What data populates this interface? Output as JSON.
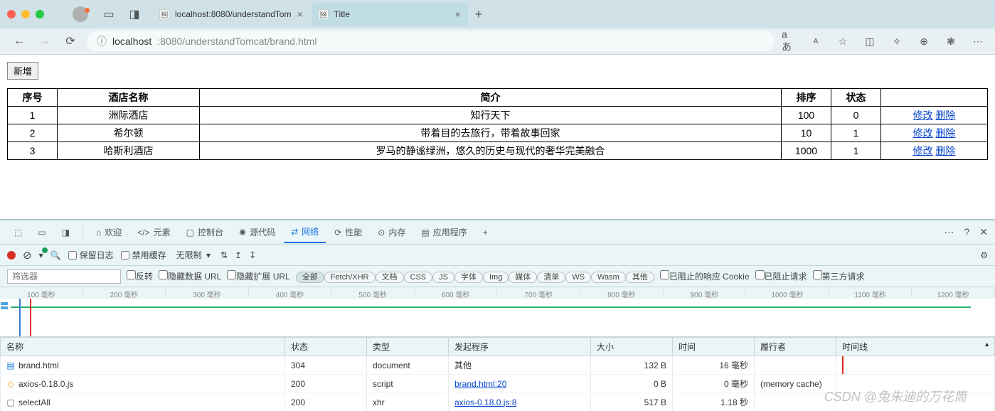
{
  "browser": {
    "tabs": [
      {
        "title": "localhost:8080/understandTom",
        "active": false
      },
      {
        "title": "Title",
        "active": true
      }
    ],
    "url": {
      "host": "localhost",
      "rest": ":8080/understandTomcat/brand.html"
    },
    "toolbar_right": {
      "aa": "aあ",
      "aA": "A"
    }
  },
  "page": {
    "add_button": "新增",
    "headers": {
      "seq": "序号",
      "name": "酒店名称",
      "intro": "简介",
      "sort": "排序",
      "status": "状态"
    },
    "rows": [
      {
        "seq": "1",
        "name": "洲际酒店",
        "intro": "知行天下",
        "sort": "100",
        "status": "0"
      },
      {
        "seq": "2",
        "name": "希尔顿",
        "intro": "带着目的去旅行，带着故事回家",
        "sort": "10",
        "status": "1"
      },
      {
        "seq": "3",
        "name": "哈斯利酒店",
        "intro": "罗马的静谧绿洲，悠久的历史与现代的奢华完美融合",
        "sort": "1000",
        "status": "1"
      }
    ],
    "actions": {
      "edit": "修改",
      "delete": "删除"
    }
  },
  "devtools": {
    "tabs": {
      "welcome": "欢迎",
      "elements": "元素",
      "console": "控制台",
      "sources": "源代码",
      "network": "网络",
      "performance": "性能",
      "memory": "内存",
      "application": "应用程序"
    },
    "toolbar": {
      "preserve_log": "保留日志",
      "disable_cache": "禁用缓存",
      "throttling": "无限制"
    },
    "filterbar": {
      "placeholder": "筛选器",
      "invert": "反转",
      "hide_data": "隐藏数据 URL",
      "hide_ext": "隐藏扩展 URL",
      "pills": [
        "全部",
        "Fetch/XHR",
        "文档",
        "CSS",
        "JS",
        "字体",
        "Img",
        "媒体",
        "清单",
        "WS",
        "Wasm",
        "其他"
      ],
      "blocked_cookie": "已阻止的响应 Cookie",
      "blocked_req": "已阻止请求",
      "third_party": "第三方请求"
    },
    "timeline": {
      "ticks": [
        "100  毫秒",
        "200  毫秒",
        "300  毫秒",
        "400  毫秒",
        "500  毫秒",
        "600  毫秒",
        "700  毫秒",
        "800  毫秒",
        "900  毫秒",
        "1000  毫秒",
        "1100  毫秒",
        "1200  毫秒"
      ]
    },
    "table": {
      "headers": {
        "name": "名称",
        "status": "状态",
        "type": "类型",
        "initiator": "发起程序",
        "size": "大小",
        "time": "时间",
        "fulfilled": "履行者",
        "timeline": "时间线"
      },
      "rows": [
        {
          "icon": "doc",
          "icon_color": "#1a73e8",
          "name": "brand.html",
          "status": "304",
          "type": "document",
          "initiator": "其他",
          "initiator_link": false,
          "size": "132 B",
          "time": "16  毫秒",
          "fulfilled": ""
        },
        {
          "icon": "js",
          "icon_color": "#f29900",
          "name": "axios-0.18.0.js",
          "status": "200",
          "type": "script",
          "initiator": "brand.html:20",
          "initiator_link": true,
          "size": "0 B",
          "time": "0  毫秒",
          "fulfilled": "(memory cache)"
        },
        {
          "icon": "file",
          "icon_color": "#666",
          "name": "selectAll",
          "status": "200",
          "type": "xhr",
          "initiator": "axios-0.18.0.js:8",
          "initiator_link": true,
          "size": "517 B",
          "time": "1.18 秒",
          "fulfilled": ""
        }
      ]
    }
  },
  "watermark": "CSDN @兔朱迪的万花筒"
}
